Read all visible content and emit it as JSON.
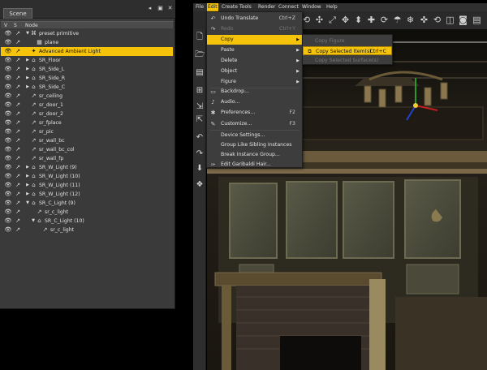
{
  "scene_panel": {
    "tab_label": "Scene",
    "tools": [
      "◂",
      "▣",
      "✕"
    ],
    "columns": {
      "v": "V",
      "s": "S",
      "node": "Node"
    },
    "nodes": [
      {
        "label": "preset primitive",
        "icon": "⌘",
        "exp": "▼",
        "depth": 0
      },
      {
        "label": "plane",
        "icon": "▦",
        "exp": "",
        "depth": 1
      },
      {
        "label": "Advanced Ambient Light",
        "icon": "✦",
        "exp": "",
        "depth": 0,
        "selected": true
      },
      {
        "label": "SR_Floor",
        "icon": "⌂",
        "exp": "▶",
        "depth": 0
      },
      {
        "label": "SR_Side_L",
        "icon": "⌂",
        "exp": "▶",
        "depth": 0
      },
      {
        "label": "SR_Side_R",
        "icon": "⌂",
        "exp": "▶",
        "depth": 0
      },
      {
        "label": "SR_Side_C",
        "icon": "⌂",
        "exp": "▶",
        "depth": 0
      },
      {
        "label": "sr_ceiling",
        "icon": "↗",
        "exp": "",
        "depth": 0
      },
      {
        "label": "sr_door_1",
        "icon": "↗",
        "exp": "",
        "depth": 0
      },
      {
        "label": "sr_door_2",
        "icon": "↗",
        "exp": "",
        "depth": 0
      },
      {
        "label": "sr_fplace",
        "icon": "↗",
        "exp": "",
        "depth": 0
      },
      {
        "label": "sr_pic",
        "icon": "↗",
        "exp": "",
        "depth": 0
      },
      {
        "label": "sr_wall_bc",
        "icon": "↗",
        "exp": "",
        "depth": 0
      },
      {
        "label": "sr_wall_bc_col",
        "icon": "↗",
        "exp": "",
        "depth": 0
      },
      {
        "label": "sr_wall_fp",
        "icon": "↗",
        "exp": "",
        "depth": 0
      },
      {
        "label": "SR_W_Light (9)",
        "icon": "⌂",
        "exp": "▶",
        "depth": 0
      },
      {
        "label": "SR_W_Light (10)",
        "icon": "⌂",
        "exp": "▶",
        "depth": 0
      },
      {
        "label": "SR_W_Light (11)",
        "icon": "⌂",
        "exp": "▶",
        "depth": 0
      },
      {
        "label": "SR_W_Light (12)",
        "icon": "⌂",
        "exp": "▶",
        "depth": 0
      },
      {
        "label": "SR_C_Light (9)",
        "icon": "⌂",
        "exp": "▼",
        "depth": 0
      },
      {
        "label": "sr_c_light",
        "icon": "↗",
        "exp": "",
        "depth": 1
      },
      {
        "label": "SR_C_Light (10)",
        "icon": "⌂",
        "exp": "▼",
        "depth": 1
      },
      {
        "label": "sr_c_light",
        "icon": "↗",
        "exp": "",
        "depth": 2
      }
    ]
  },
  "menubar": {
    "items": [
      "File",
      "Edit",
      "Create",
      "Tools",
      "Render",
      "Connect",
      "Window",
      "Help"
    ],
    "active": "Edit"
  },
  "edit_menu": {
    "items": [
      {
        "label": "Undo Translate",
        "shortcut": "Ctrl+Z",
        "icon": "↶",
        "disabled": false,
        "submenu": false
      },
      {
        "label": "Redo",
        "shortcut": "Ctrl+Y",
        "icon": "↷",
        "disabled": true,
        "submenu": false
      },
      {
        "label": "Copy",
        "shortcut": "",
        "icon": "",
        "disabled": false,
        "submenu": true,
        "highlight": true
      },
      {
        "label": "Paste",
        "shortcut": "",
        "icon": "",
        "disabled": false,
        "submenu": true
      },
      {
        "label": "Delete",
        "shortcut": "",
        "icon": "",
        "disabled": false,
        "submenu": true
      },
      {
        "label": "Object",
        "shortcut": "",
        "icon": "",
        "disabled": false,
        "submenu": true
      },
      {
        "label": "Figure",
        "shortcut": "",
        "icon": "",
        "disabled": false,
        "submenu": true
      },
      {
        "label": "Backdrop...",
        "shortcut": "",
        "icon": "▭",
        "disabled": false,
        "submenu": false
      },
      {
        "label": "Audio...",
        "shortcut": "",
        "icon": "♪",
        "disabled": false,
        "submenu": false
      },
      {
        "label": "Preferences...",
        "shortcut": "F2",
        "icon": "✱",
        "disabled": false,
        "submenu": false
      },
      {
        "label": "Customize...",
        "shortcut": "F3",
        "icon": "✎",
        "disabled": false,
        "submenu": false
      },
      {
        "label": "Device Settings...",
        "shortcut": "",
        "icon": "",
        "disabled": false,
        "submenu": false
      },
      {
        "label": "Group Like Sibling Instances",
        "shortcut": "",
        "icon": "",
        "disabled": false,
        "submenu": false
      },
      {
        "label": "Break Instance Group...",
        "shortcut": "",
        "icon": "",
        "disabled": false,
        "submenu": false
      },
      {
        "label": "Edit Garibaldi Hair...",
        "shortcut": "",
        "icon": "✑",
        "disabled": false,
        "submenu": false
      }
    ]
  },
  "copy_submenu": {
    "items": [
      {
        "label": "Copy Figure",
        "shortcut": "",
        "disabled": true
      },
      {
        "label": "Copy Selected Item(s)",
        "shortcut": "Ctrl+C",
        "disabled": false,
        "highlight": true
      },
      {
        "label": "Copy Selected Surface(s)",
        "shortcut": "",
        "disabled": true
      }
    ]
  },
  "colors": {
    "accent": "#f4c30a",
    "panel": "#3a3a3a",
    "menu": "#3d3d3d"
  }
}
